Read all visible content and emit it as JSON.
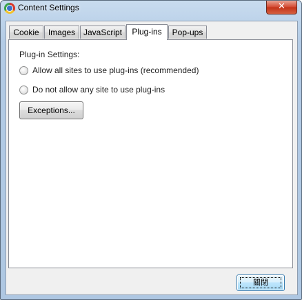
{
  "window": {
    "title": "Content Settings",
    "close_glyph": "✕"
  },
  "tabs": [
    {
      "label": "Cookie"
    },
    {
      "label": "Images"
    },
    {
      "label": "JavaScript"
    },
    {
      "label": "Plug-ins",
      "active": true
    },
    {
      "label": "Pop-ups"
    }
  ],
  "plugins": {
    "section_label": "Plug-in Settings:",
    "options": [
      {
        "label": "Allow all sites to use plug-ins (recommended)",
        "selected": false
      },
      {
        "label": "Do not allow any site to use plug-ins",
        "selected": false
      }
    ],
    "exceptions_label": "Exceptions..."
  },
  "footer": {
    "close_label": "關閉"
  },
  "icons": {
    "app": "chrome-icon",
    "close": "close-icon"
  }
}
